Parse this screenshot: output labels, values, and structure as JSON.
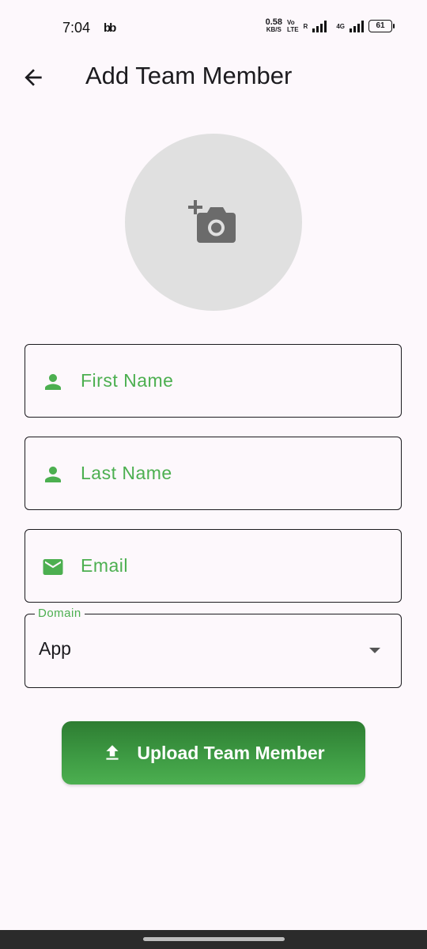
{
  "status_bar": {
    "time": "7:04",
    "app_icon": "bb",
    "net_speed_value": "0.58",
    "net_speed_unit": "KB/S",
    "volte_top": "Vo",
    "volte_bottom": "LTE",
    "volte_suffix": "R",
    "network_type": "4G",
    "battery": "61"
  },
  "app_bar": {
    "back_icon": "arrow-left-icon",
    "title": "Add Team Member"
  },
  "avatar": {
    "icon": "add-a-photo-icon"
  },
  "form": {
    "first_name": {
      "placeholder": "First Name",
      "value": "",
      "icon": "person-icon"
    },
    "last_name": {
      "placeholder": "Last Name",
      "value": "",
      "icon": "person-icon"
    },
    "email": {
      "placeholder": "Email",
      "value": "",
      "icon": "mail-icon"
    },
    "domain": {
      "label": "Domain",
      "value": "App",
      "icon": "dropdown-arrow-icon"
    }
  },
  "upload_button": {
    "label": "Upload Team Member",
    "icon": "upload-icon"
  },
  "colors": {
    "accent": "#4caf50",
    "accent_dark": "#2e7d32",
    "background": "#fdf8fc",
    "avatar_bg": "#e0e0e0"
  }
}
